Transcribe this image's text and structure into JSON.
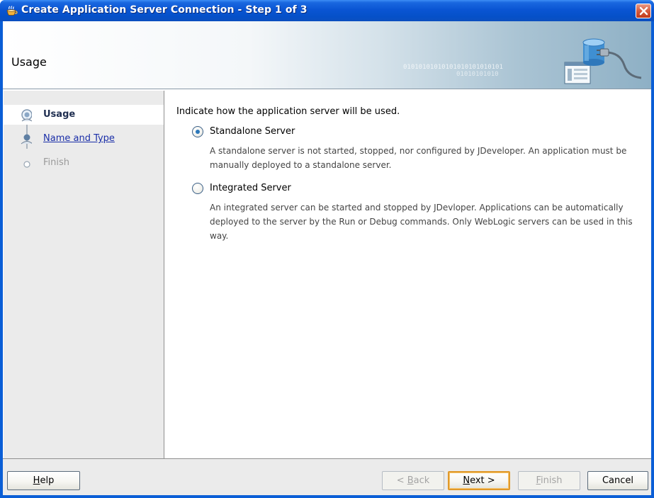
{
  "window": {
    "title": "Create Application Server Connection - Step 1 of 3"
  },
  "header": {
    "title": "Usage",
    "binary_text": "01010101010101010101010101",
    "binary_text_2": "01010101010"
  },
  "nav": {
    "items": [
      {
        "label": "Usage",
        "state": "current"
      },
      {
        "label": "Name and Type",
        "state": "link"
      },
      {
        "label": "Finish",
        "state": "disabled"
      }
    ]
  },
  "content": {
    "intro": "Indicate how the application server will be used.",
    "options": [
      {
        "label": "Standalone Server",
        "checked": true,
        "description": "A standalone server is not started, stopped, nor configured by JDeveloper. An application must be manually deployed to a standalone server."
      },
      {
        "label": "Integrated Server",
        "checked": false,
        "description": "An integrated server can be started and stopped by JDevloper. Applications can be automatically deployed to the server by the Run or Debug commands. Only WebLogic servers can be used in this way."
      }
    ]
  },
  "footer": {
    "help": {
      "mnemonic": "H",
      "rest": "elp"
    },
    "back": {
      "prefix": "< ",
      "mnemonic": "B",
      "rest": "ack",
      "enabled": false
    },
    "next": {
      "mnemonic": "N",
      "rest": "ext >",
      "enabled": true,
      "default": true
    },
    "finish": {
      "mnemonic": "F",
      "rest": "inish",
      "enabled": false
    },
    "cancel": {
      "label": "Cancel",
      "enabled": true
    }
  },
  "colors": {
    "titlebar": "#0a55d3",
    "close_button": "#d65b3e",
    "nav_background": "#ebebeb",
    "link": "#1a2ea8",
    "default_button_border": "#e09a2c"
  }
}
